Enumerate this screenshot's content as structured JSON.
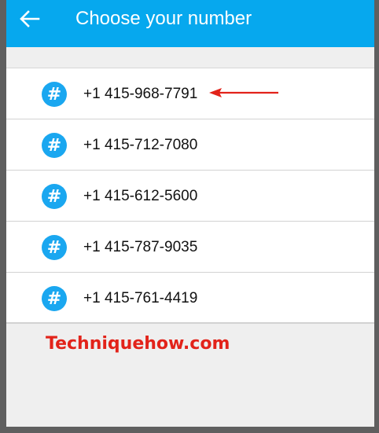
{
  "app_bar": {
    "title": "Choose your number",
    "back_icon": "arrow-left-icon",
    "color": "#06a8ee"
  },
  "numbers": [
    {
      "icon": "hash-icon",
      "glyph": "#",
      "value": "+1 415-968-7791",
      "highlighted": true
    },
    {
      "icon": "hash-icon",
      "glyph": "#",
      "value": "+1 415-712-7080"
    },
    {
      "icon": "hash-icon",
      "glyph": "#",
      "value": "+1 415-612-5600"
    },
    {
      "icon": "hash-icon",
      "glyph": "#",
      "value": "+1 415-787-9035"
    },
    {
      "icon": "hash-icon",
      "glyph": "#",
      "value": "+1 415-761-4419"
    }
  ],
  "annotation": {
    "arrow_icon": "red-arrow-icon",
    "color": "#e2231a"
  },
  "watermark": "Techniquehow.com"
}
